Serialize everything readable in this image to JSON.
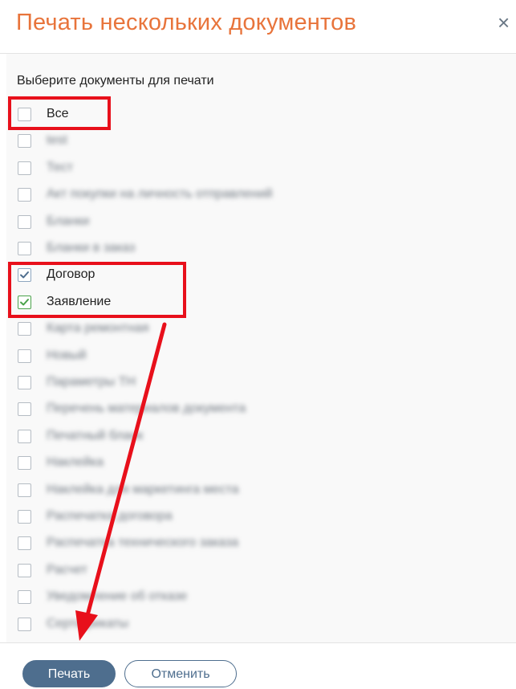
{
  "dialog": {
    "title": "Печать нескольких документов",
    "close_glyph": "×",
    "prompt": "Выберите документы для печати"
  },
  "documents": [
    {
      "label": "Все",
      "checked": false,
      "blurred": false
    },
    {
      "label": "test",
      "checked": false,
      "blurred": true
    },
    {
      "label": "Тест",
      "checked": false,
      "blurred": true
    },
    {
      "label": "Акт покупки на личность отправлений",
      "checked": false,
      "blurred": true
    },
    {
      "label": "Бланки",
      "checked": false,
      "blurred": true
    },
    {
      "label": "Бланки в заказ",
      "checked": false,
      "blurred": true
    },
    {
      "label": "Договор",
      "checked": true,
      "blurred": false
    },
    {
      "label": "Заявление",
      "checked": true,
      "blurred": false
    },
    {
      "label": "Карта ремонтная",
      "checked": false,
      "blurred": true
    },
    {
      "label": "Новый",
      "checked": false,
      "blurred": true
    },
    {
      "label": "Параметры ТН",
      "checked": false,
      "blurred": true
    },
    {
      "label": "Перечень материалов документа",
      "checked": false,
      "blurred": true
    },
    {
      "label": "Печатный бланк",
      "checked": false,
      "blurred": true
    },
    {
      "label": "Наклейка",
      "checked": false,
      "blurred": true
    },
    {
      "label": "Наклейка для маркетинга места",
      "checked": false,
      "blurred": true
    },
    {
      "label": "Распечатка договора",
      "checked": false,
      "blurred": true
    },
    {
      "label": "Распечатка технического заказа",
      "checked": false,
      "blurred": true
    },
    {
      "label": "Расчет",
      "checked": false,
      "blurred": true
    },
    {
      "label": "Уведомление об отказе",
      "checked": false,
      "blurred": true
    },
    {
      "label": "Сертификаты",
      "checked": false,
      "blurred": true
    }
  ],
  "footer": {
    "print_label": "Печать",
    "cancel_label": "Отменить"
  },
  "colors": {
    "title": "#e8743b",
    "accent": "#4e6e8e",
    "highlight": "#e8101b",
    "check_blue": "#4e6e8e",
    "check_green": "#4aa24a"
  }
}
